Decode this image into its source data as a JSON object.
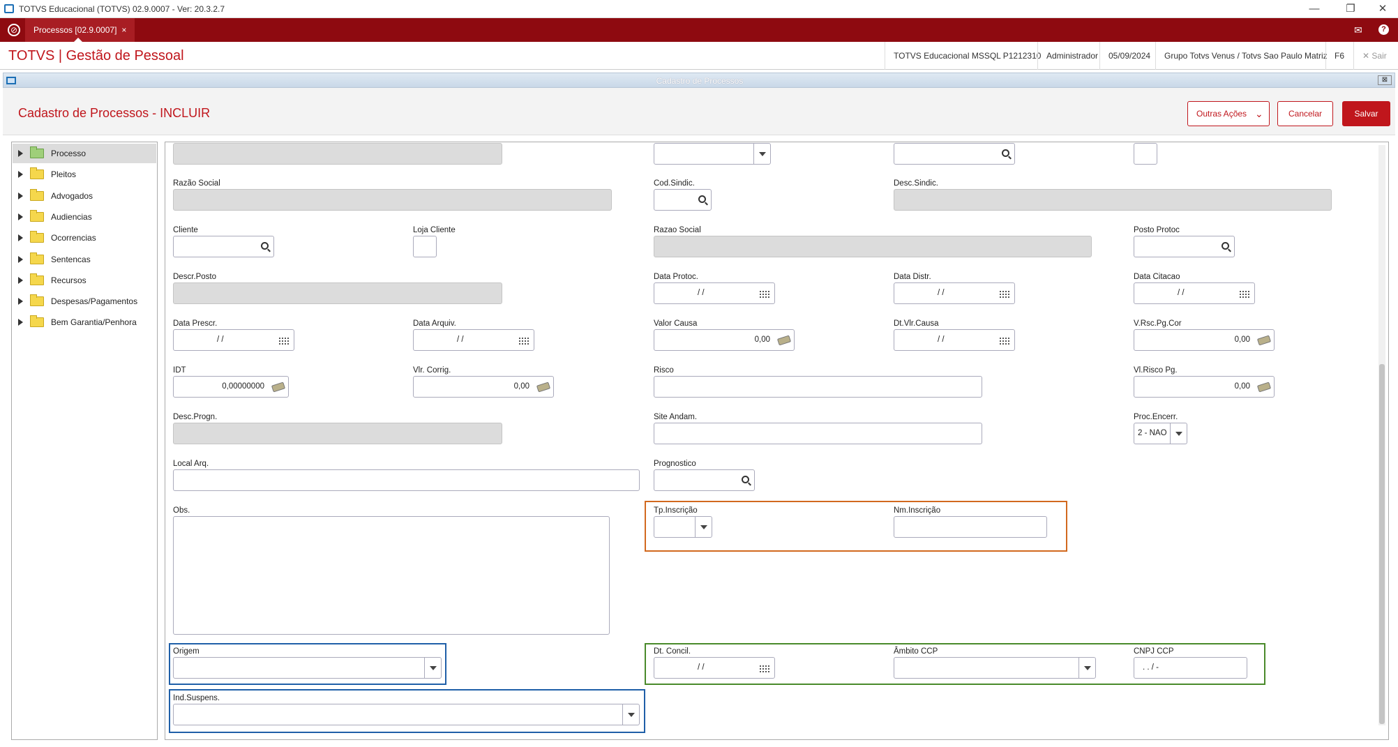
{
  "window": {
    "title": "TOTVS Educacional (TOTVS) 02.9.0007 - Ver: 20.3.2.7",
    "min": "—",
    "restore": "❐",
    "close": "✕"
  },
  "tabbar": {
    "tab_label": "Processos [02.9.0007]",
    "tab_close": "×",
    "mail_icon": "✉",
    "help_icon": "?"
  },
  "header": {
    "brand": "TOTVS | Gestão de Pessoal",
    "environment": "TOTVS Educacional MSSQL P1212310",
    "user": "Administrador",
    "date": "05/09/2024",
    "company": "Grupo Totvs Venus / Totvs Sao Paulo Matriz",
    "shortcut": "F6",
    "exit": "✕  Sair"
  },
  "dialog": {
    "title": "Cadastro de Processos",
    "close": "⊠"
  },
  "form": {
    "title": "Cadastro de Processos - INCLUIR",
    "btn_more": "Outras Ações",
    "btn_cancel": "Cancelar",
    "btn_save": "Salvar"
  },
  "tree": [
    {
      "label": "Processo",
      "selected": true
    },
    {
      "label": "Pleitos"
    },
    {
      "label": "Advogados"
    },
    {
      "label": "Audiencias"
    },
    {
      "label": "Ocorrencias"
    },
    {
      "label": "Sentencas"
    },
    {
      "label": "Recursos"
    },
    {
      "label": "Despesas/Pagamentos"
    },
    {
      "label": "Bem Garantia/Penhora"
    }
  ],
  "fields": {
    "razao_social": {
      "label": "Razão Social",
      "value": ""
    },
    "cod_sindic": {
      "label": "Cod.Sindic.",
      "value": ""
    },
    "desc_sindic": {
      "label": "Desc.Sindic.",
      "value": ""
    },
    "cliente": {
      "label": "Cliente",
      "value": ""
    },
    "loja_cliente": {
      "label": "Loja Cliente",
      "value": ""
    },
    "razao_social2": {
      "label": "Razao Social",
      "value": ""
    },
    "posto_protoc": {
      "label": "Posto Protoc",
      "value": ""
    },
    "descr_posto": {
      "label": "Descr.Posto",
      "value": ""
    },
    "data_protoc": {
      "label": "Data Protoc.",
      "value": "/ /"
    },
    "data_distr": {
      "label": "Data Distr.",
      "value": "/ /"
    },
    "data_citacao": {
      "label": "Data Citacao",
      "value": "/ /"
    },
    "data_prescr": {
      "label": "Data Prescr.",
      "value": "/ /"
    },
    "data_arquiv": {
      "label": "Data Arquiv.",
      "value": "/ /"
    },
    "valor_causa": {
      "label": "Valor Causa",
      "value": "0,00"
    },
    "dt_vlr_causa": {
      "label": "Dt.Vlr.Causa",
      "value": "/ /"
    },
    "v_rsc_pg_cor": {
      "label": "V.Rsc.Pg.Cor",
      "value": "0,00"
    },
    "idt": {
      "label": "IDT",
      "value": "0,00000000"
    },
    "vlr_corrig": {
      "label": "Vlr. Corrig.",
      "value": "0,00"
    },
    "risco": {
      "label": "Risco",
      "value": ""
    },
    "vl_risco_pg": {
      "label": "Vl.Risco Pg.",
      "value": "0,00"
    },
    "desc_progn": {
      "label": "Desc.Progn.",
      "value": ""
    },
    "site_andam": {
      "label": "Site Andam.",
      "value": ""
    },
    "proc_encerr": {
      "label": "Proc.Encerr.",
      "value": "2 - NAO"
    },
    "local_arq": {
      "label": "Local Arq.",
      "value": ""
    },
    "prognostico": {
      "label": "Prognostico",
      "value": ""
    },
    "obs": {
      "label": "Obs.",
      "value": ""
    },
    "tp_inscricao": {
      "label": "Tp.Inscrição",
      "value": ""
    },
    "nm_inscricao": {
      "label": "Nm.Inscrição",
      "value": ""
    },
    "origem": {
      "label": "Origem",
      "value": ""
    },
    "dt_concil": {
      "label": "Dt. Concil.",
      "value": "/ /"
    },
    "ambito_ccp": {
      "label": "Âmbito CCP",
      "value": ""
    },
    "cnpj_ccp": {
      "label": "CNPJ CCP",
      "value": ".  .  /  -"
    },
    "ind_suspens": {
      "label": "Ind.Suspens.",
      "value": ""
    }
  },
  "colors": {
    "brand_red": "#8e0a10",
    "accent_red": "#c0161c",
    "highlight_orange": "#d2691e",
    "highlight_blue": "#1f5fa8",
    "highlight_green": "#4a8a2a"
  }
}
